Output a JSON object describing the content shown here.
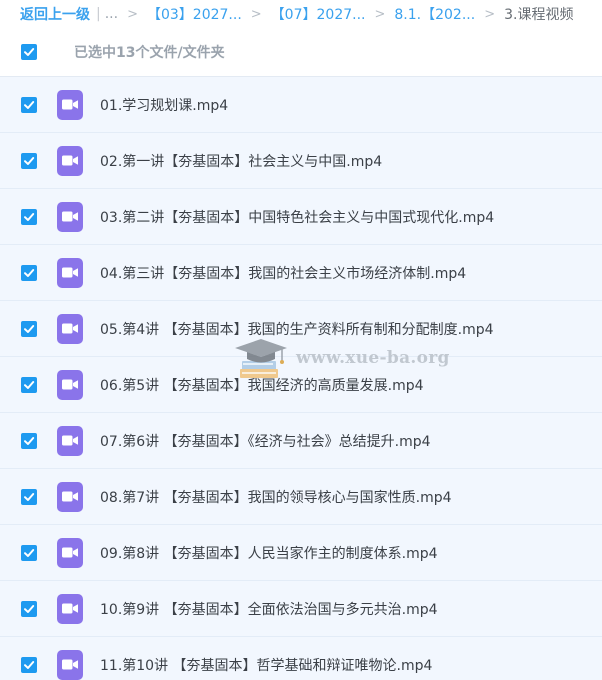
{
  "breadcrumb": {
    "back": "返回上一级",
    "divider": "|",
    "ellipsis": "...",
    "separator": ">",
    "crumbs": [
      "【03】2027...",
      "【07】2027...",
      "8.1.【202..."
    ],
    "current": "3.课程视频"
  },
  "selection": {
    "label": "已选中13个文件/文件夹"
  },
  "files": [
    "01.学习规划课.mp4",
    "02.第一讲【夯基固本】社会主义与中国.mp4",
    "03.第二讲【夯基固本】中国特色社会主义与中国式现代化.mp4",
    "04.第三讲【夯基固本】我国的社会主义市场经济体制.mp4",
    "05.第4讲 【夯基固本】我国的生产资料所有制和分配制度.mp4",
    "06.第5讲 【夯基固本】我国经济的高质量发展.mp4",
    "07.第6讲 【夯基固本】《经济与社会》总结提升.mp4",
    "08.第7讲 【夯基固本】我国的领导核心与国家性质.mp4",
    "09.第8讲 【夯基固本】人民当家作主的制度体系.mp4",
    "10.第9讲 【夯基固本】全面依法治国与多元共治.mp4",
    "11.第10讲 【夯基固本】哲学基础和辩证唯物论.mp4"
  ],
  "watermark": {
    "text": "www.xue-ba.org"
  },
  "colors": {
    "link": "#3aa1ee",
    "checkbox": "#1e9af0",
    "video_icon": "#8a74ea",
    "row_background": "#f2f7fe"
  }
}
